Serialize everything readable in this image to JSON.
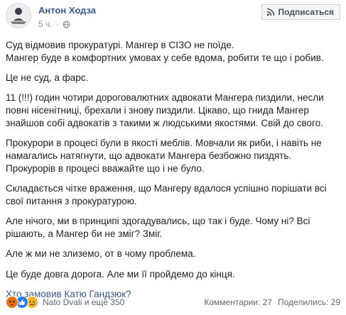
{
  "header": {
    "author_name": "Антон Ходза",
    "time": "5 ч.",
    "subscribe_label": "Подписаться",
    "avatar_caption": "ХТО ЗАМОВИВ КАТЮ ГАНДЗЮК?",
    "privacy_icon": "globe-icon"
  },
  "post": {
    "paragraphs": [
      [
        "Суд відмовив прокуратурі. Мангер в СІЗО не поїде.",
        "Мангер буде в комфортних умовах у себе вдома, робити те що і робив."
      ],
      [
        "Це не суд, а фарс."
      ],
      [
        "11 (!!!) годин чотири дороговалютних адвокати Мангера пиздили, несли",
        "повні нісенітниці, брехали і знову пиздили. Цікаво, що гнида Мангер",
        "знайшов собі адвокатів з такими ж людськими якостями. Свій до свого."
      ],
      [
        "Прокурори в процесі були в якості меблів. Мовчали як риби, і навіть не",
        "намагались натягнути, що адвокати Мангера безбожно пиздять.",
        "Прокурорів в процесі вважайте що і не було."
      ],
      [
        "Складається чітке враження, що Мангеру вдалося успішно порішати всі",
        "свої питання з прокуратурою."
      ],
      [
        "Але нічого, ми в принципі здогадувались, що так і буде. Чому ні? Всі",
        "рішають, а Мангер би не зміг? Зміг."
      ],
      [
        "Але ж ми не злиземо, от в чому проблема."
      ],
      [
        "Це буде довга дорога. Але ми її пройдемо до кінця."
      ]
    ],
    "link_text": "Хто замовив Катю Гандзюк?"
  },
  "footer": {
    "reactors": "Nato Dvali и ещё 350",
    "comments": "Комментарии: 27",
    "shares": "Поделились: 29",
    "reaction_icons": [
      "angry-reaction-icon",
      "like-reaction-icon",
      "sad-reaction-icon"
    ]
  },
  "colors": {
    "link": "#385898",
    "author": "#365899",
    "meta": "#90949c",
    "like": "#2078f4",
    "angry": "#e9710f",
    "sad": "#f7b125"
  }
}
